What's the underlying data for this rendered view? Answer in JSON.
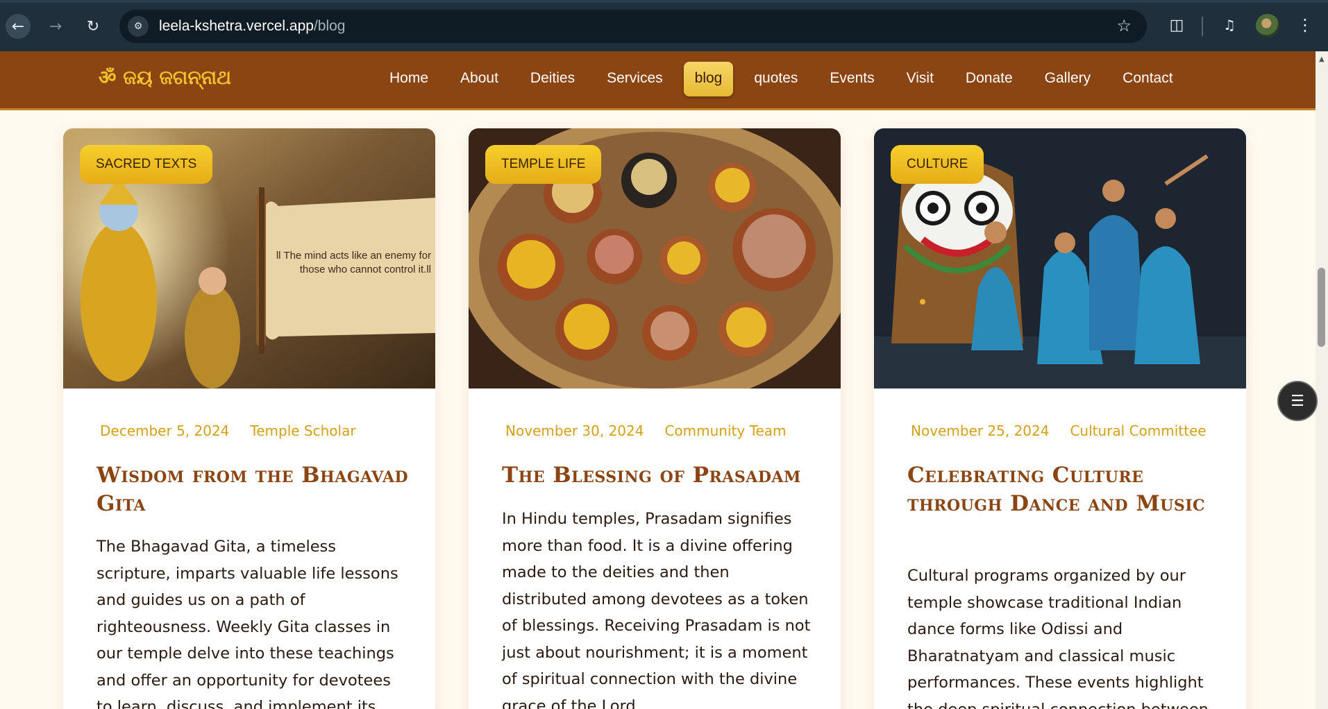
{
  "browser": {
    "url_host": "leela-kshetra.vercel.app",
    "url_path": "/blog"
  },
  "site": {
    "logo": "ॐ ଜୟ ଜଗନ୍ନାଥ",
    "nav": [
      {
        "label": "Home"
      },
      {
        "label": "About"
      },
      {
        "label": "Deities"
      },
      {
        "label": "Services"
      },
      {
        "label": "blog",
        "active": true
      },
      {
        "label": "quotes"
      },
      {
        "label": "Events"
      },
      {
        "label": "Visit"
      },
      {
        "label": "Donate"
      },
      {
        "label": "Gallery"
      },
      {
        "label": "Contact"
      }
    ]
  },
  "posts": [
    {
      "category": "SACRED TEXTS",
      "date": "December 5, 2024",
      "author": "Temple Scholar",
      "title": "Wisdom from the Bhagavad Gita",
      "excerpt": "The Bhagavad Gita, a timeless scripture, imparts valuable life lessons and guides us on a path of righteousness. Weekly Gita classes in our temple delve into these teachings and offer an opportunity for devotees to learn, discuss, and implement its",
      "image_quote": "ll The mind acts like an enemy for those who cannot control it.ll"
    },
    {
      "category": "TEMPLE LIFE",
      "date": "November 30, 2024",
      "author": "Community Team",
      "title": "The Blessing of Prasadam",
      "excerpt": "In Hindu temples, Prasadam signifies more than food. It is a divine offering made to the deities and then distributed among devotees as a token of blessings. Receiving Prasadam is not just about nourishment; it is a moment of spiritual connection with the divine grace of the Lord."
    },
    {
      "category": "CULTURE",
      "date": "November 25, 2024",
      "author": "Cultural Committee",
      "title": "Celebrating Culture through Dance and Music",
      "excerpt": "Cultural programs organized by our temple showcase traditional Indian dance forms like Odissi and Bharatnatyam and classical music performances. These events highlight the deep spiritual connection between"
    }
  ],
  "colors": {
    "header": "#8b4513",
    "accent": "#d4a017",
    "badge": "#f6cf2c",
    "title": "#8b4513"
  }
}
